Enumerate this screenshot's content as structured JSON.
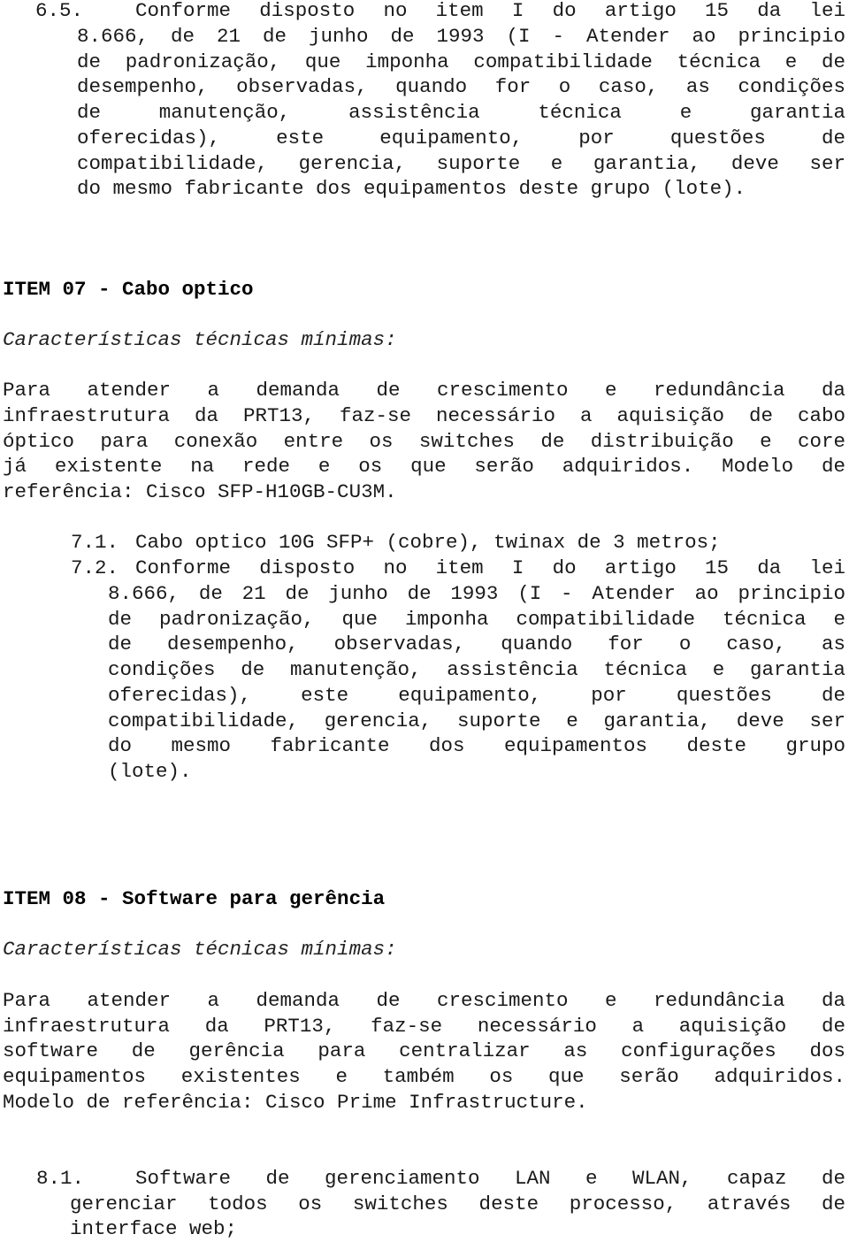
{
  "section_6_5": {
    "number": "6.5.",
    "lines": [
      "Conforme disposto no item I do artigo 15 da lei",
      "8.666, de 21 de junho de 1993 (I - Atender ao principio",
      "de padronização, que imponha compatibilidade técnica e de",
      "desempenho, observadas, quando for o caso, as condições",
      "de manutenção, assistência técnica e garantia",
      "oferecidas), este equipamento, por questões de",
      "compatibilidade, gerencia, suporte e garantia, deve ser",
      "do mesmo fabricante dos equipamentos deste grupo (lote)."
    ]
  },
  "item_07": {
    "title": "ITEM 07 - Cabo optico",
    "subtitle": "Características técnicas mínimas:",
    "paragraph_lines": [
      "Para atender a demanda de crescimento e redundância da",
      "infraestrutura da PRT13, faz-se necessário a aquisição de cabo",
      "óptico para conexão entre os switches de distribuição e core",
      "já existente na rede e os que serão adquiridos. Modelo de",
      "referência: Cisco SFP-H10GB-CU3M."
    ],
    "subitems": [
      {
        "number": "7.1.",
        "lines": [
          "Cabo optico 10G SFP+ (cobre), twinax de 3 metros;"
        ]
      },
      {
        "number": "7.2.",
        "lines": [
          "Conforme disposto no item I do artigo 15 da lei",
          "8.666, de 21 de junho de 1993 (I - Atender ao principio",
          "de padronização, que imponha compatibilidade técnica e",
          "de desempenho, observadas, quando for o caso, as",
          "condições de manutenção, assistência técnica e garantia",
          "oferecidas), este equipamento, por questões de",
          "compatibilidade, gerencia, suporte e garantia, deve ser",
          "do mesmo fabricante dos equipamentos deste grupo",
          "(lote)."
        ]
      }
    ]
  },
  "item_08": {
    "title": "ITEM 08 - Software para gerência",
    "subtitle": "Características técnicas mínimas:",
    "paragraph_lines": [
      "Para atender a demanda de crescimento e redundância da",
      "infraestrutura da PRT13, faz-se necessário a aquisição de",
      "software de gerência para centralizar as configurações dos",
      "equipamentos existentes e também os que serão adquiridos.",
      "Modelo de referência: Cisco Prime Infrastructure."
    ],
    "subitems": [
      {
        "number": "8.1.",
        "lines": [
          "Software de gerenciamento LAN e WLAN, capaz de",
          "gerenciar todos os switches deste processo, através de",
          "interface web;"
        ]
      }
    ]
  }
}
